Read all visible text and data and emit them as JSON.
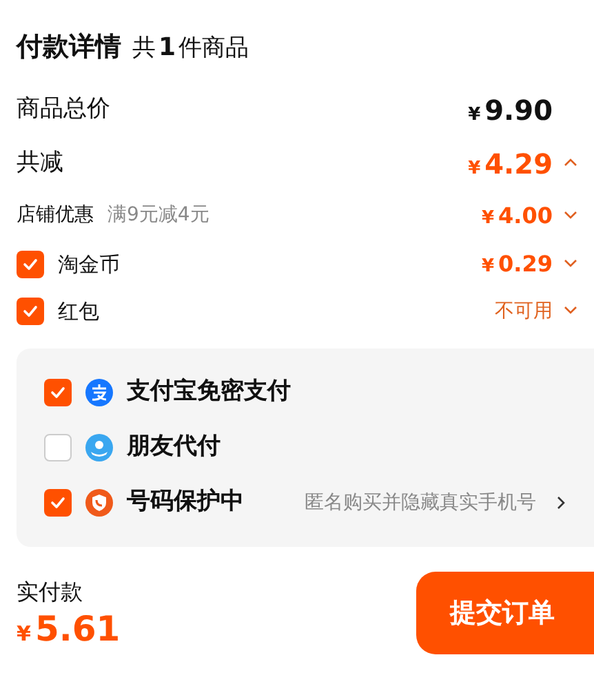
{
  "header": {
    "title": "付款详情",
    "count_prefix": "共",
    "count": "1",
    "count_suffix": "件商品"
  },
  "rows": [
    {
      "kind": "total",
      "label": "商品总价",
      "currency": "¥",
      "amount": "9.90"
    },
    {
      "kind": "discount",
      "label": "共减",
      "currency": "¥",
      "amount": "4.29",
      "expanded": true
    },
    {
      "kind": "sub",
      "label": "店铺优惠",
      "note": "满9元减4元",
      "currency": "¥",
      "amount": "4.00",
      "expanded": false
    },
    {
      "kind": "check",
      "label": "淘金币",
      "checked": true,
      "currency": "¥",
      "amount": "0.29",
      "expanded": false
    },
    {
      "kind": "check",
      "label": "红包",
      "checked": true,
      "status": "不可用",
      "expanded": false
    }
  ],
  "options": [
    {
      "kind": "alipay",
      "label": "支付宝免密支付",
      "checked": true
    },
    {
      "kind": "friend",
      "label": "朋友代付",
      "checked": false
    },
    {
      "kind": "shield",
      "label": "号码保护中",
      "checked": true,
      "note": "匿名购买并隐藏真实手机号"
    }
  ],
  "footer": {
    "label": "实付款",
    "currency": "¥",
    "amount": "5.61",
    "button": "提交订单"
  }
}
